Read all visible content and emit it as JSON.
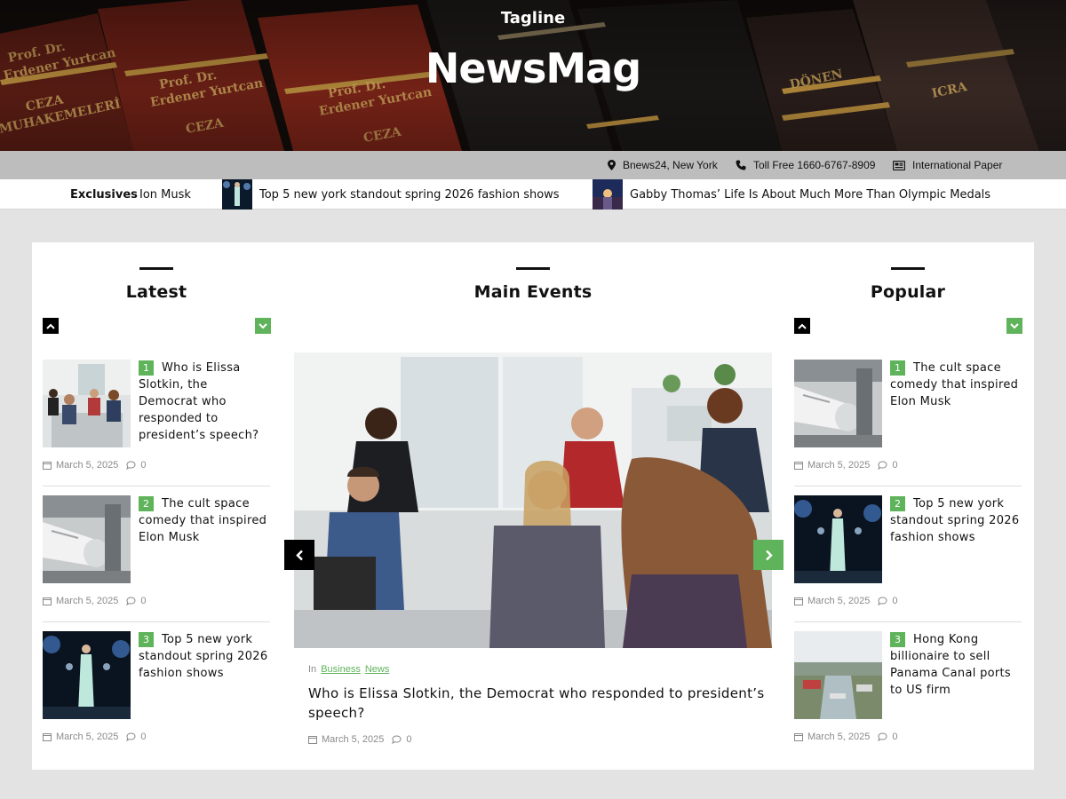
{
  "header": {
    "tagline": "Tagline",
    "site_title": "NewsMag"
  },
  "infobar": {
    "location": "Bnews24, New York",
    "phone": "Toll Free 1660-6767-8909",
    "paper": "International Paper"
  },
  "ticker": {
    "label": "Exclusives",
    "items": [
      "Ion Musk",
      "Top 5 new york standout spring 2026 fashion shows",
      "Gabby Thomas’ Life Is About Much More Than Olympic Medals"
    ]
  },
  "latest": {
    "heading": "Latest",
    "posts": [
      {
        "num": "1",
        "title": "Who is Elissa Slotkin, the Democrat who responded to president’s speech?",
        "date": "March 5, 2025",
        "comments": "0"
      },
      {
        "num": "2",
        "title": "The cult space comedy that inspired Elon Musk",
        "date": "March 5, 2025",
        "comments": "0"
      },
      {
        "num": "3",
        "title": "Top 5 new york standout spring 2026 fashion shows",
        "date": "March 5, 2025",
        "comments": "0"
      }
    ]
  },
  "main_events": {
    "heading": "Main Events",
    "categories_prefix": "In",
    "categories": [
      "Business",
      "News"
    ],
    "title": "Who is Elissa Slotkin, the Democrat who responded to president’s speech?",
    "date": "March 5, 2025",
    "comments": "0"
  },
  "popular": {
    "heading": "Popular",
    "posts": [
      {
        "num": "1",
        "title": "The cult space comedy that inspired Elon Musk",
        "date": "March 5, 2025",
        "comments": "0"
      },
      {
        "num": "2",
        "title": "Top 5 new york standout spring 2026 fashion shows",
        "date": "March 5, 2025",
        "comments": "0"
      },
      {
        "num": "3",
        "title": "Hong Kong billionaire to sell Panama Canal ports to US firm",
        "date": "March 5, 2025",
        "comments": "0"
      }
    ]
  },
  "colors": {
    "accent_green": "#5fb35a",
    "infobar_bg": "#bdbdbd",
    "page_bg": "#e3e3e3"
  },
  "icons": {
    "location": "map-pin-icon",
    "phone": "phone-icon",
    "paper": "newspaper-icon",
    "date": "calendar-icon",
    "comments": "comment-icon",
    "scroll_up": "chevron-up-icon",
    "scroll_down": "chevron-down-icon",
    "prev": "chevron-left-icon",
    "next": "chevron-right-icon"
  }
}
